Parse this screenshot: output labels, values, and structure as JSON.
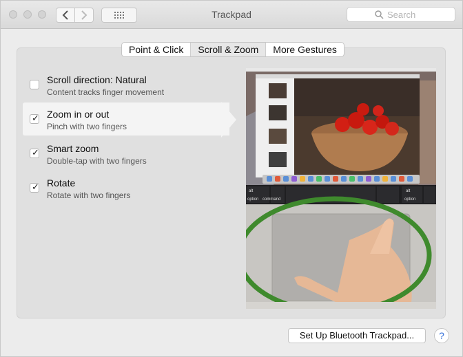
{
  "window": {
    "title": "Trackpad"
  },
  "toolbar": {
    "search_placeholder": "Search"
  },
  "tabs": [
    {
      "label": "Point & Click",
      "selected": false
    },
    {
      "label": "Scroll & Zoom",
      "selected": true
    },
    {
      "label": "More Gestures",
      "selected": false
    }
  ],
  "options": [
    {
      "title": "Scroll direction: Natural",
      "desc": "Content tracks finger movement",
      "checked": false
    },
    {
      "title": "Zoom in or out",
      "desc": "Pinch with two fingers",
      "checked": true,
      "selected": true
    },
    {
      "title": "Smart zoom",
      "desc": "Double-tap with two fingers",
      "checked": true
    },
    {
      "title": "Rotate",
      "desc": "Rotate with two fingers",
      "checked": true
    }
  ],
  "preview": {
    "keys": {
      "left_top": "alt",
      "left": "option",
      "command": "command",
      "right_top": "alt",
      "right": "option"
    }
  },
  "footer": {
    "setup_button": "Set Up Bluetooth Trackpad...",
    "help": "?"
  },
  "colors": {
    "highlight_ring": "#3f8a2d",
    "checkbox_border": "#b4b4b4"
  }
}
